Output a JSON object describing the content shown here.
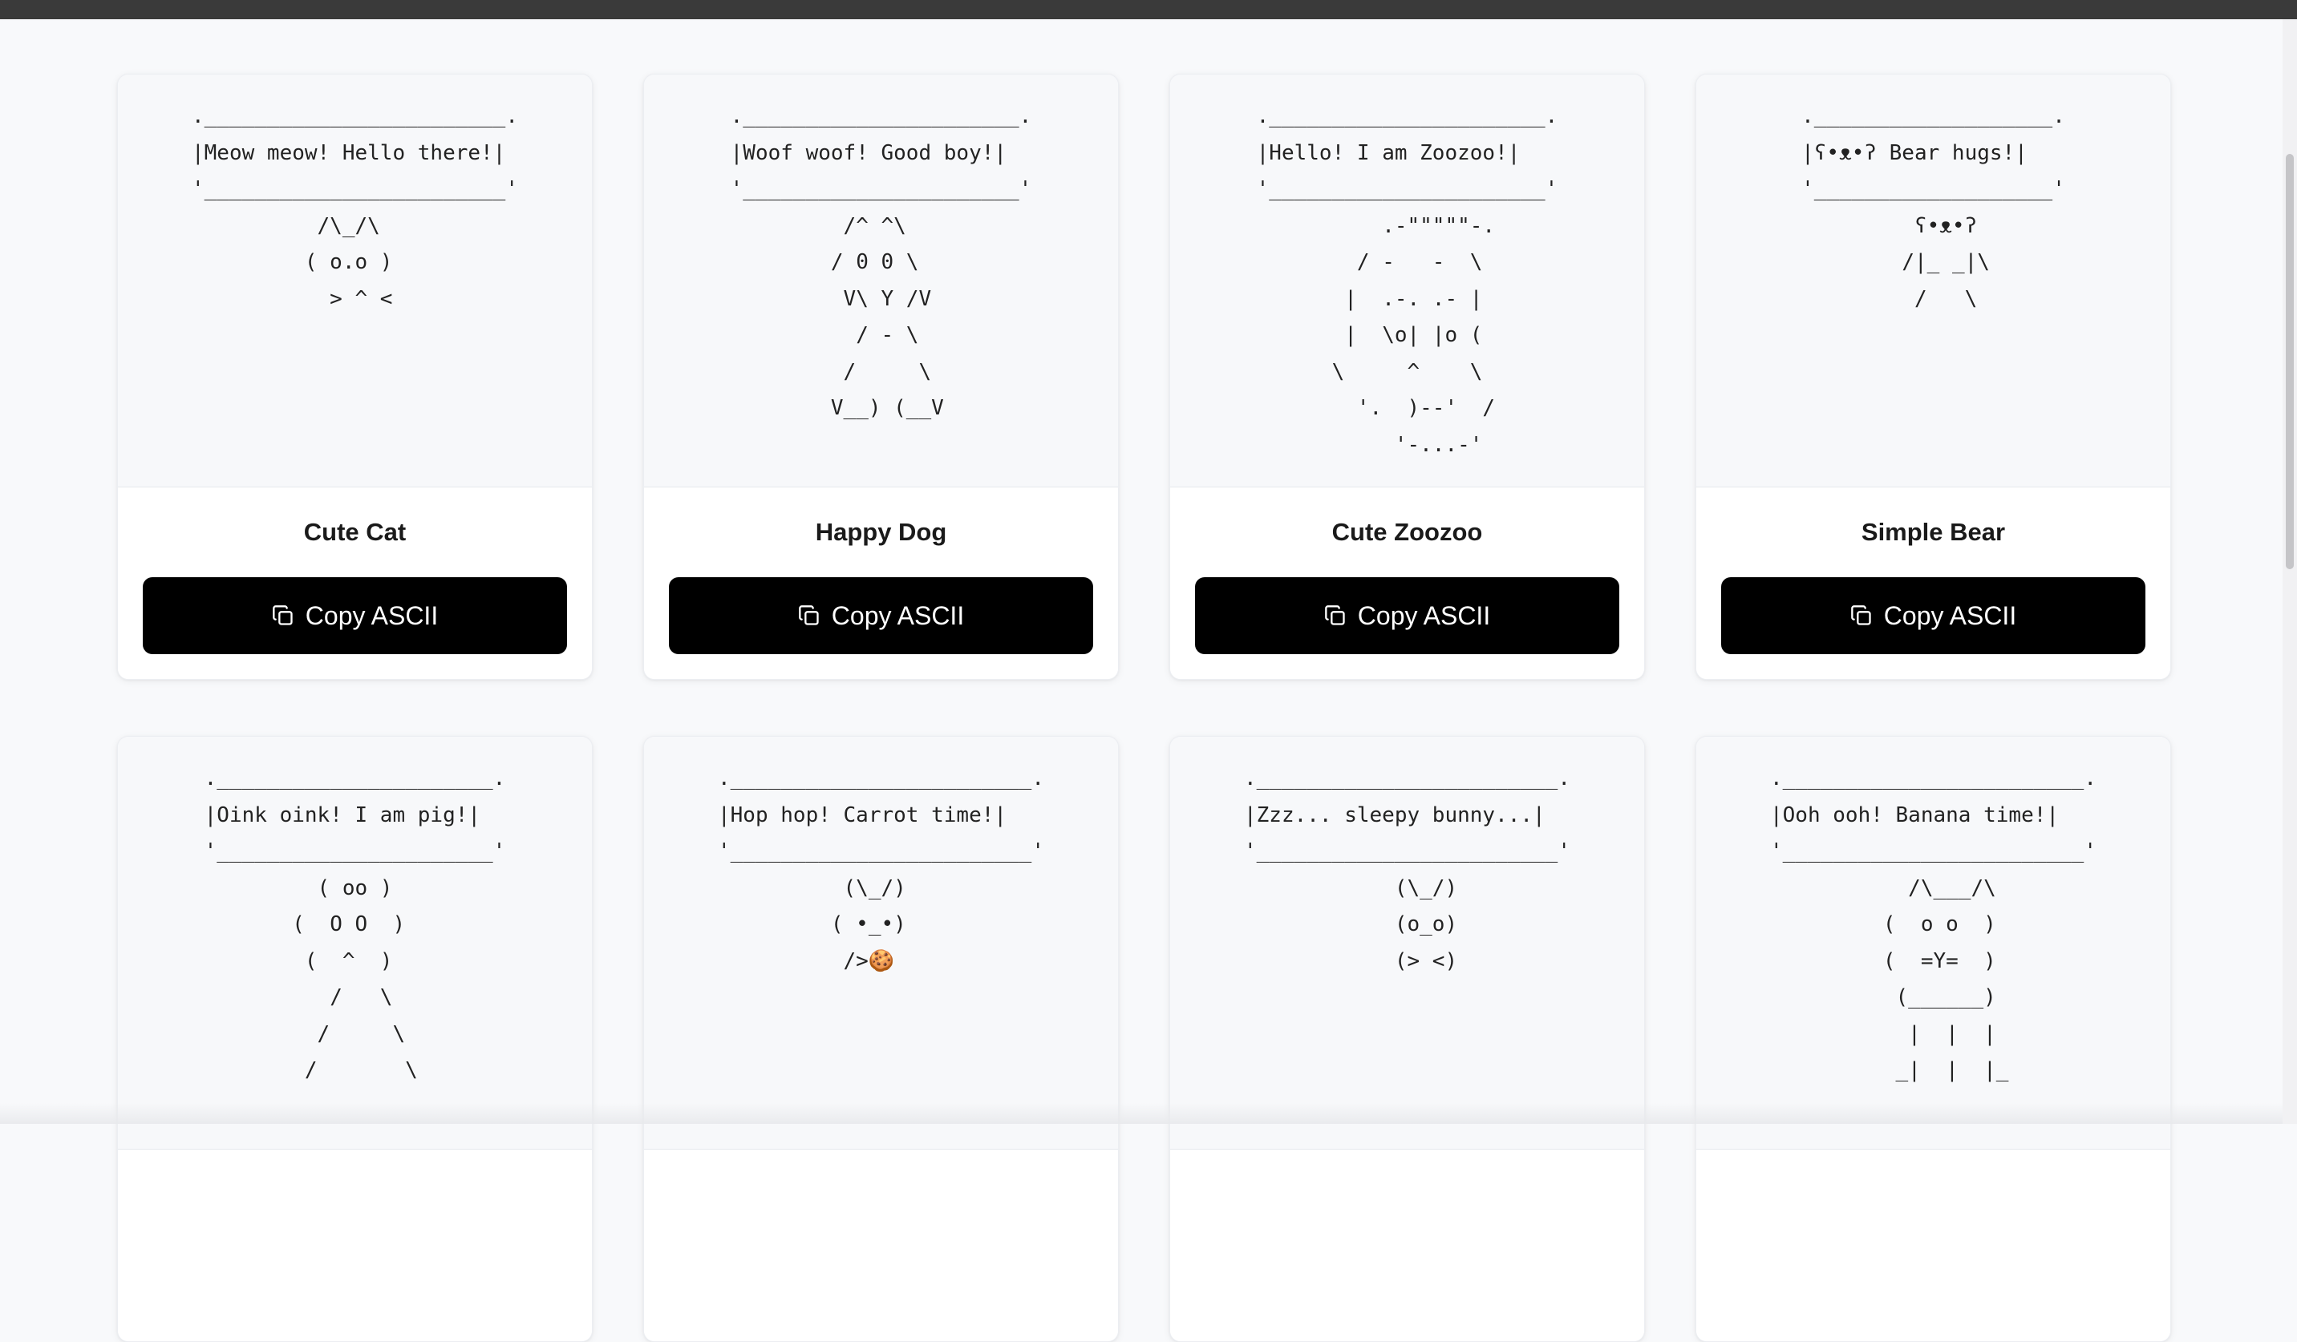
{
  "copy_label": "Copy ASCII",
  "cards": [
    {
      "name": "Cute Cat",
      "art": ".________________________.\n|Meow meow! Hello there!|\n'________________________'\n          /\\_/\\\n         ( o.o )\n           > ^ <"
    },
    {
      "name": "Happy Dog",
      "art": ".______________________.\n|Woof woof! Good boy!|\n'______________________'\n         /^ ^\\\n        / 0 0 \\\n         V\\ Y /V\n          / - \\\n         /     \\\n        V__) (__V"
    },
    {
      "name": "Cute Zoozoo",
      "art": ".______________________.\n|Hello! I am Zoozoo!|\n'______________________'\n          .-\"\"\"\"\"-.\n        / -   -  \\\n       |  .-. .- |\n       |  \\o| |o (\n      \\     ^    \\\n        '.  )--'  /\n           '-...-'"
    },
    {
      "name": "Simple Bear",
      "art": ".___________________.\n|ʕ•ᴥ•ʔ Bear hugs!|\n'___________________'\n         ʕ•ᴥ•ʔ\n        /|_ _|\\\n         /   \\"
    },
    {
      "name": "",
      "art": ".______________________.\n|Oink oink! I am pig!|\n'______________________'\n         ( oo )\n       (  O O  )\n        (  ^  )\n          /   \\\n         /     \\\n        /       \\"
    },
    {
      "name": "",
      "art": ".________________________.\n|Hop hop! Carrot time!|\n'________________________'\n          (\\_/)\n         ( •_•)\n          />🍪"
    },
    {
      "name": "",
      "art": ".________________________.\n|Zzz... sleepy bunny...|\n'________________________'\n            (\\_/)\n            (o_o)\n            (> <)"
    },
    {
      "name": "",
      "art": ".________________________.\n|Ooh ooh! Banana time!|\n'________________________'\n           /\\___/\\\n         (  o o  )\n         (  =Y=  )\n          (______)\n           |  |  |\n          _|  |  |_"
    }
  ]
}
